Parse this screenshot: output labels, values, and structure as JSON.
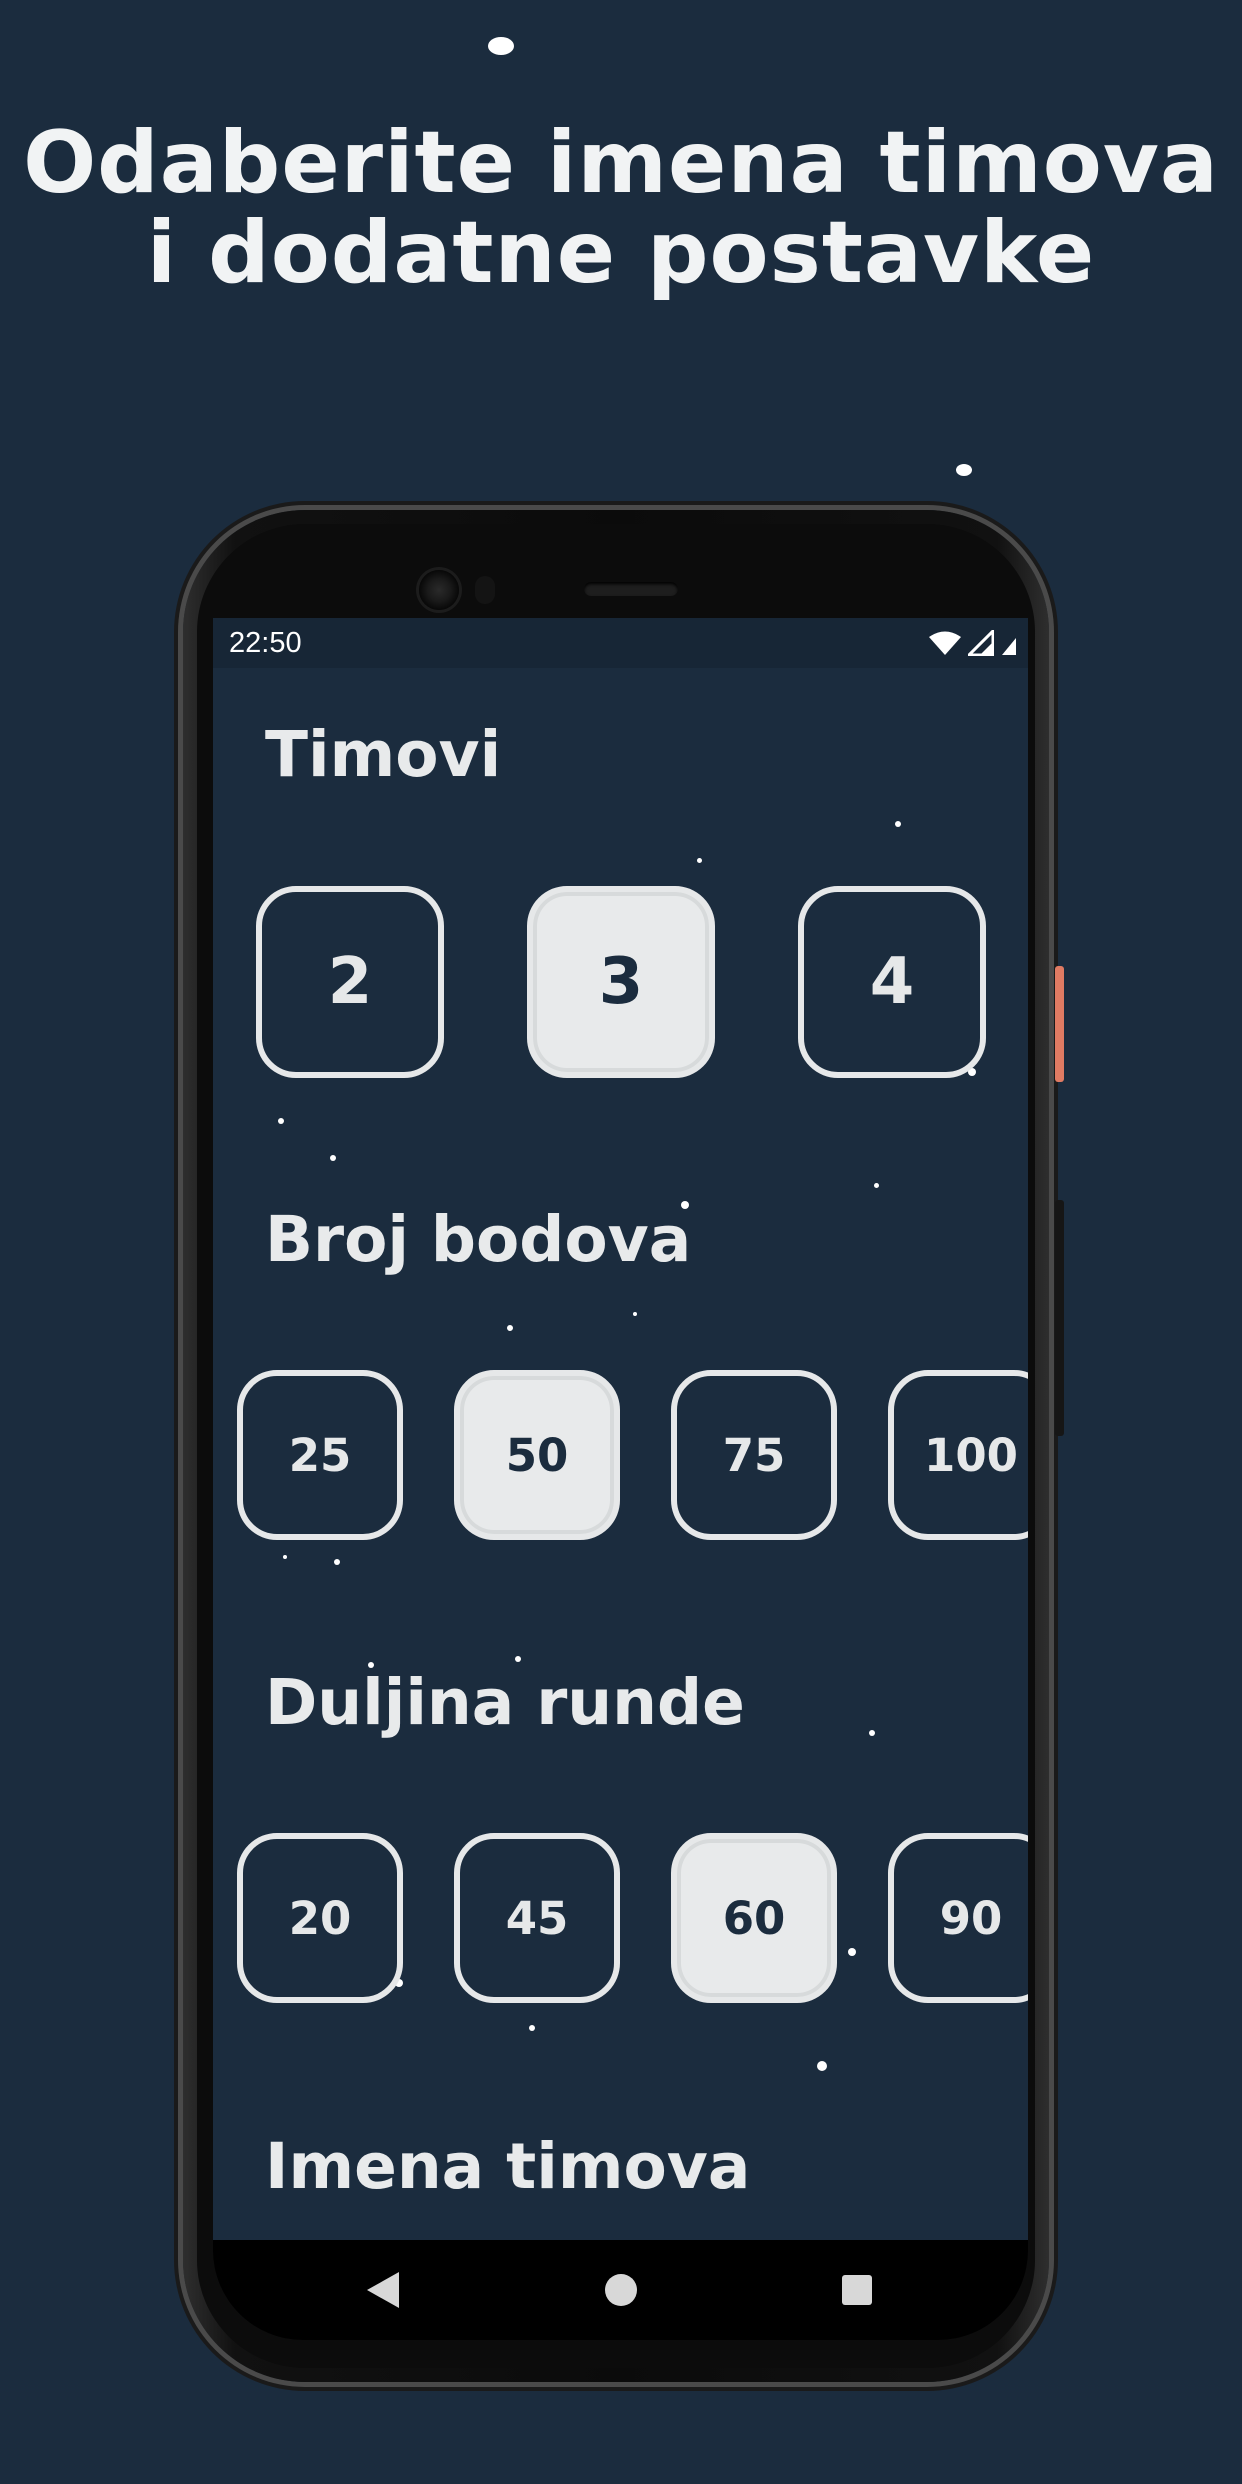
{
  "headline": {
    "line1": "Odaberite imena timova",
    "line2": "i dodatne postavke"
  },
  "status_bar": {
    "time": "22:50",
    "icons": [
      "wifi-icon",
      "signal-icon",
      "battery-icon"
    ]
  },
  "sections": {
    "teams": {
      "title": "Timovi",
      "options": [
        "2",
        "3",
        "4"
      ],
      "selected": "3"
    },
    "points": {
      "title": "Broj bodova",
      "options": [
        "25",
        "50",
        "75",
        "100"
      ],
      "selected": "50"
    },
    "round_length": {
      "title": "Duljina runde",
      "options": [
        "20",
        "45",
        "60",
        "90"
      ],
      "selected": "60"
    },
    "team_names": {
      "title": "Imena timova"
    }
  },
  "nav_bar": {
    "icons": [
      "back-triangle-icon",
      "home-circle-icon",
      "recents-square-icon"
    ]
  },
  "colors": {
    "background": "#1b2c3e",
    "selected_fill": "#e8eaeb",
    "accent_button": "#e07b63"
  }
}
